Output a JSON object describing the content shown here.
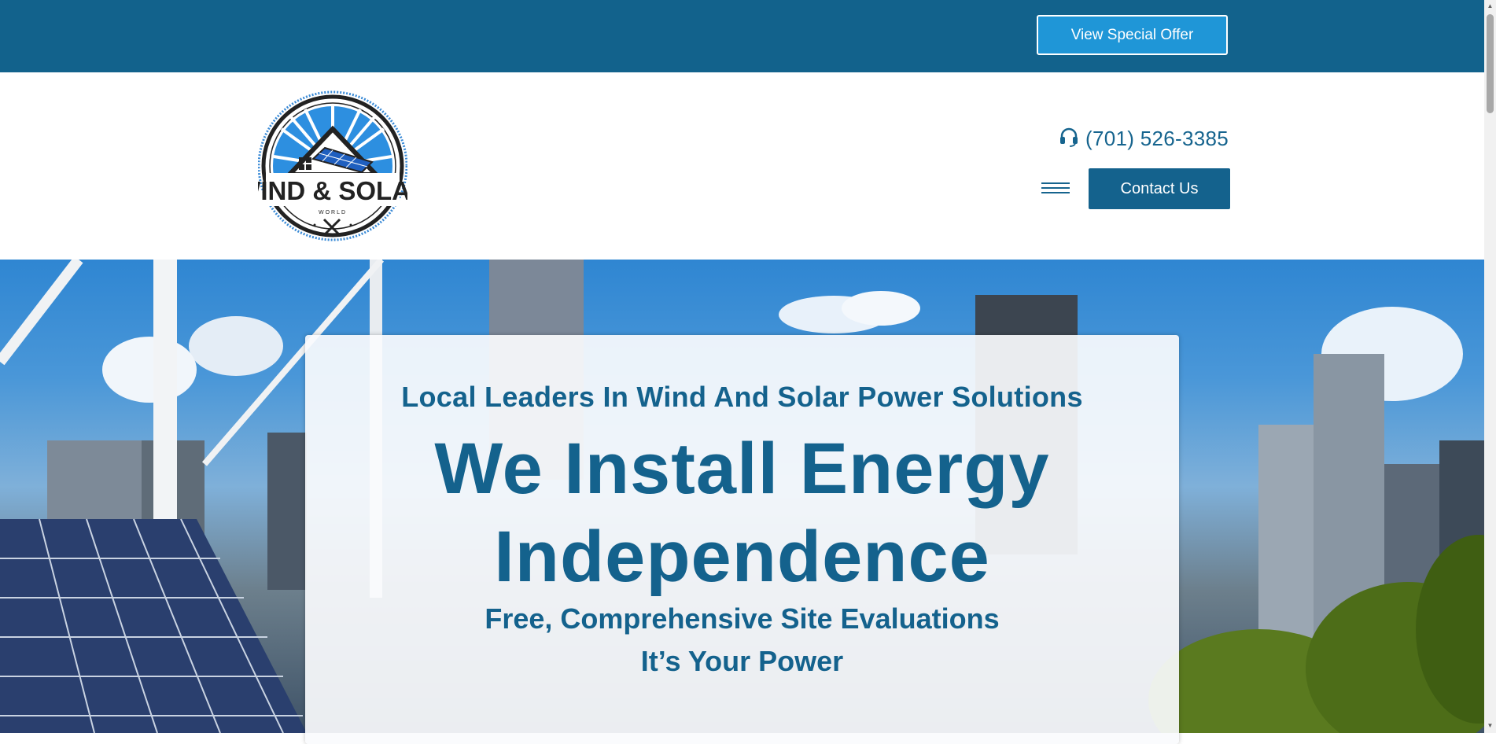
{
  "topbar": {
    "offer_label": "View Special Offer"
  },
  "header": {
    "logo": {
      "line1": "WIND & SOLAR",
      "line2": "WORLD",
      "icon": "house-solar-logo"
    },
    "phone": {
      "icon": "headset-icon",
      "number": "(701) 526-3385"
    },
    "menu_icon": "hamburger-icon",
    "contact_label": "Contact Us"
  },
  "hero": {
    "tagline": "Local Leaders In Wind And Solar Power Solutions",
    "headline_line1": "We Install Energy",
    "headline_line2": "Independence",
    "sub1": "Free, Comprehensive Site Evaluations",
    "sub2": "It’s Your Power"
  },
  "colors": {
    "brand_blue": "#14628d",
    "accent_blue": "#1f96d7",
    "topbar_blue": "#12628c"
  }
}
